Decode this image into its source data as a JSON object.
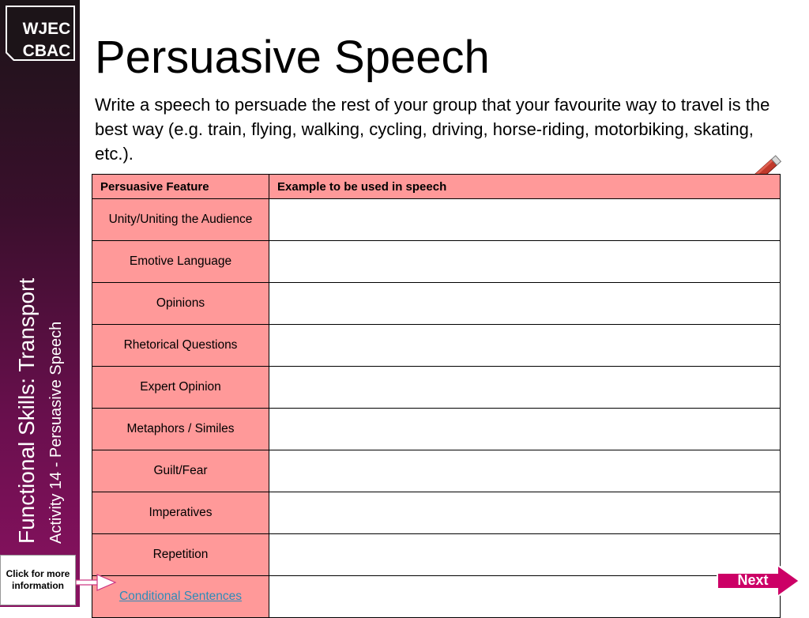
{
  "logo": {
    "line1": "WJEC",
    "line2": "CBAC"
  },
  "sidebar": {
    "title": "Functional Skills: Transport",
    "subtitle": "Activity 14 -  Persuasive Speech",
    "info_button": "Click for more information"
  },
  "page": {
    "title": "Persuasive Speech",
    "intro": "Write a speech to persuade the rest of your group that your favourite way to travel is the best way (e.g. train, flying, walking, cycling, driving, horse-riding, motorbiking, skating, etc.)."
  },
  "table": {
    "headers": [
      "Persuasive Feature",
      "Example to be used in speech"
    ],
    "rows": [
      {
        "feature": "Unity/Uniting the Audience",
        "example": ""
      },
      {
        "feature": "Emotive Language",
        "example": ""
      },
      {
        "feature": "Opinions",
        "example": ""
      },
      {
        "feature": "Rhetorical Questions",
        "example": ""
      },
      {
        "feature": "Expert Opinion",
        "example": ""
      },
      {
        "feature": "Metaphors / Similes",
        "example": ""
      },
      {
        "feature": "Guilt/Fear",
        "example": ""
      },
      {
        "feature": "Imperatives",
        "example": ""
      },
      {
        "feature": "Repetition",
        "example": ""
      },
      {
        "feature": "Conditional Sentences",
        "example": ""
      }
    ]
  },
  "nav": {
    "next_label": "Next"
  },
  "colors": {
    "header_bg": "#ff9999",
    "next_bg": "#cc0066",
    "link": "#2e8bb8"
  },
  "icons": [
    "pencil-icon",
    "arrow-right-icon"
  ]
}
